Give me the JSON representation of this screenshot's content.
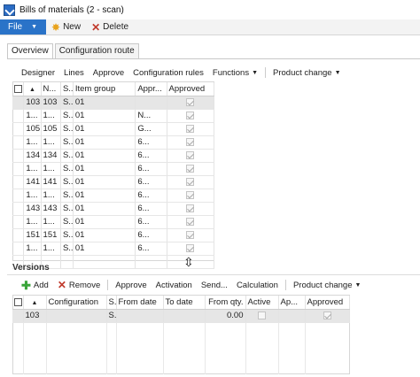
{
  "window": {
    "title": "Bills of materials (2 - scan)"
  },
  "ribbon": {
    "file_label": "File",
    "new_label": "New",
    "delete_label": "Delete"
  },
  "tabs": [
    {
      "label": "Overview",
      "active": true
    },
    {
      "label": "Configuration route",
      "active": false
    }
  ],
  "top_toolbar": {
    "items": [
      "Designer",
      "Lines",
      "Approve",
      "Configuration rules",
      "Functions",
      "Product change"
    ]
  },
  "top_grid": {
    "headers": [
      "",
      "N...",
      "S...",
      "Item group",
      "Appr...",
      "Approved"
    ],
    "rows": [
      {
        "c1": "103",
        "c2": "103",
        "c3": "S...",
        "c4": "01",
        "c5": "",
        "approved": true,
        "selected": true
      },
      {
        "c1": "1...",
        "c2": "1...",
        "c3": "S...",
        "c4": "01",
        "c5": "N...",
        "approved": true,
        "selected": false
      },
      {
        "c1": "105",
        "c2": "105",
        "c3": "S...",
        "c4": "01",
        "c5": "G...",
        "approved": true,
        "selected": false
      },
      {
        "c1": "1...",
        "c2": "1...",
        "c3": "S...",
        "c4": "01",
        "c5": "6...",
        "approved": true,
        "selected": false
      },
      {
        "c1": "134",
        "c2": "134",
        "c3": "S...",
        "c4": "01",
        "c5": "6...",
        "approved": true,
        "selected": false
      },
      {
        "c1": "1...",
        "c2": "1...",
        "c3": "S...",
        "c4": "01",
        "c5": "6...",
        "approved": true,
        "selected": false
      },
      {
        "c1": "141",
        "c2": "141",
        "c3": "S...",
        "c4": "01",
        "c5": "6...",
        "approved": true,
        "selected": false
      },
      {
        "c1": "1...",
        "c2": "1...",
        "c3": "S...",
        "c4": "01",
        "c5": "6...",
        "approved": true,
        "selected": false
      },
      {
        "c1": "143",
        "c2": "143",
        "c3": "S...",
        "c4": "01",
        "c5": "6...",
        "approved": true,
        "selected": false
      },
      {
        "c1": "1...",
        "c2": "1...",
        "c3": "S...",
        "c4": "01",
        "c5": "6...",
        "approved": true,
        "selected": false
      },
      {
        "c1": "151",
        "c2": "151",
        "c3": "S...",
        "c4": "01",
        "c5": "6...",
        "approved": true,
        "selected": false
      },
      {
        "c1": "1...",
        "c2": "1...",
        "c3": "S...",
        "c4": "01",
        "c5": "6...",
        "approved": true,
        "selected": false
      }
    ]
  },
  "versions": {
    "section_label": "Versions",
    "toolbar": {
      "add_label": "Add",
      "remove_label": "Remove",
      "approve_label": "Approve",
      "activation_label": "Activation",
      "send_label": "Send...",
      "calculation_label": "Calculation",
      "product_change_label": "Product change"
    },
    "headers": [
      "",
      "Configuration",
      "S...",
      "From date",
      "To date",
      "From qty.",
      "Active",
      "Ap...",
      "Approved"
    ],
    "rows": [
      {
        "c1": "103",
        "configuration": "",
        "s": "S...",
        "from_date": "",
        "to_date": "",
        "from_qty": "0.00",
        "active": false,
        "ap": "",
        "approved": true,
        "selected": true
      }
    ]
  }
}
